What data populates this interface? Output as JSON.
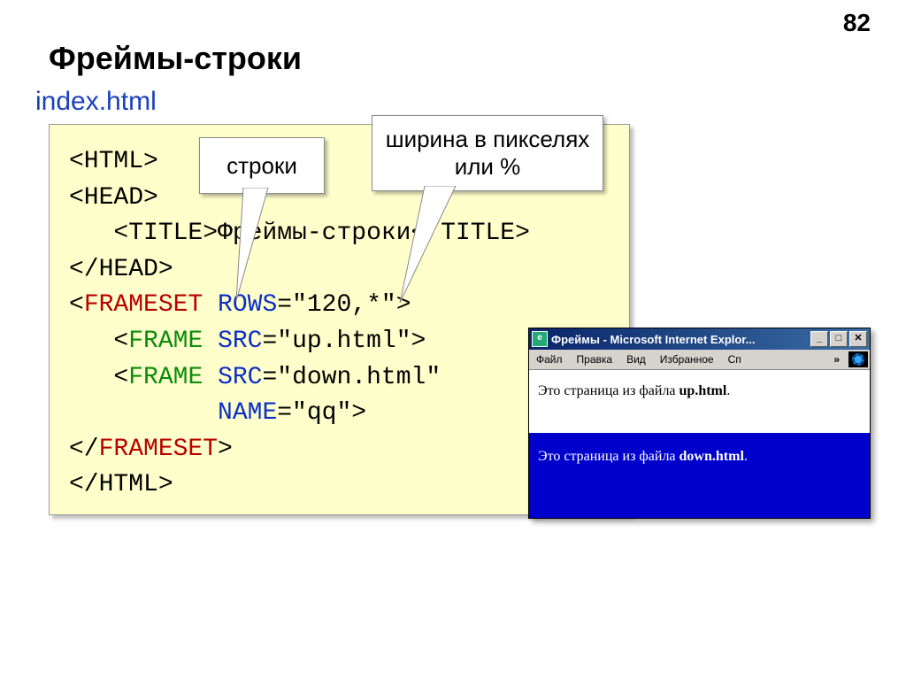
{
  "pageNumber": "82",
  "heading": "Фреймы-строки",
  "subtitle": "index.html",
  "callout1": "строки",
  "callout2": "ширина в пикселях или %",
  "code": {
    "line1_open": "<HTML>",
    "line2_open": "<HEAD>",
    "line3_title_open": "<TITLE>",
    "line3_text": "Фреймы-строки",
    "line3_title_close": "</TITLE>",
    "line4_close": "</HEAD>",
    "frameset_open_lt": "<",
    "frameset_open_tag": "FRAMESET",
    "frameset_rows_attr": "ROWS",
    "frameset_rows_val": "=\"120,*\"",
    "frameset_open_gt": ">",
    "frame1_lt": "<",
    "frame1_tag": "FRAME",
    "frame1_src_attr": "SRC",
    "frame1_src_val": "=\"up.html\"",
    "frame1_gt": ">",
    "frame2_lt": "<",
    "frame2_tag": "FRAME",
    "frame2_src_attr": "SRC",
    "frame2_src_val": "=\"down.html\"",
    "frame2_name_attr": "NAME",
    "frame2_name_val": "=\"qq\"",
    "frame2_gt": ">",
    "frameset_close_lt": "</",
    "frameset_close_tag": "FRAMESET",
    "frameset_close_gt": ">",
    "html_close": "</HTML>"
  },
  "browser": {
    "title": "Фреймы - Microsoft Internet Explor...",
    "menu": {
      "file": "Файл",
      "edit": "Правка",
      "view": "Вид",
      "favorites": "Избранное",
      "more": "Сп",
      "chev": "»"
    },
    "winbtns": {
      "min": "_",
      "max": "□",
      "close": "✕"
    },
    "frameTopPrefix": "Это страница из файла ",
    "frameTopBold": "up.html",
    "frameTopSuffix": ".",
    "frameBottomPrefix": "Это страница из файла ",
    "frameBottomBold": "down.html",
    "frameBottomSuffix": "."
  }
}
